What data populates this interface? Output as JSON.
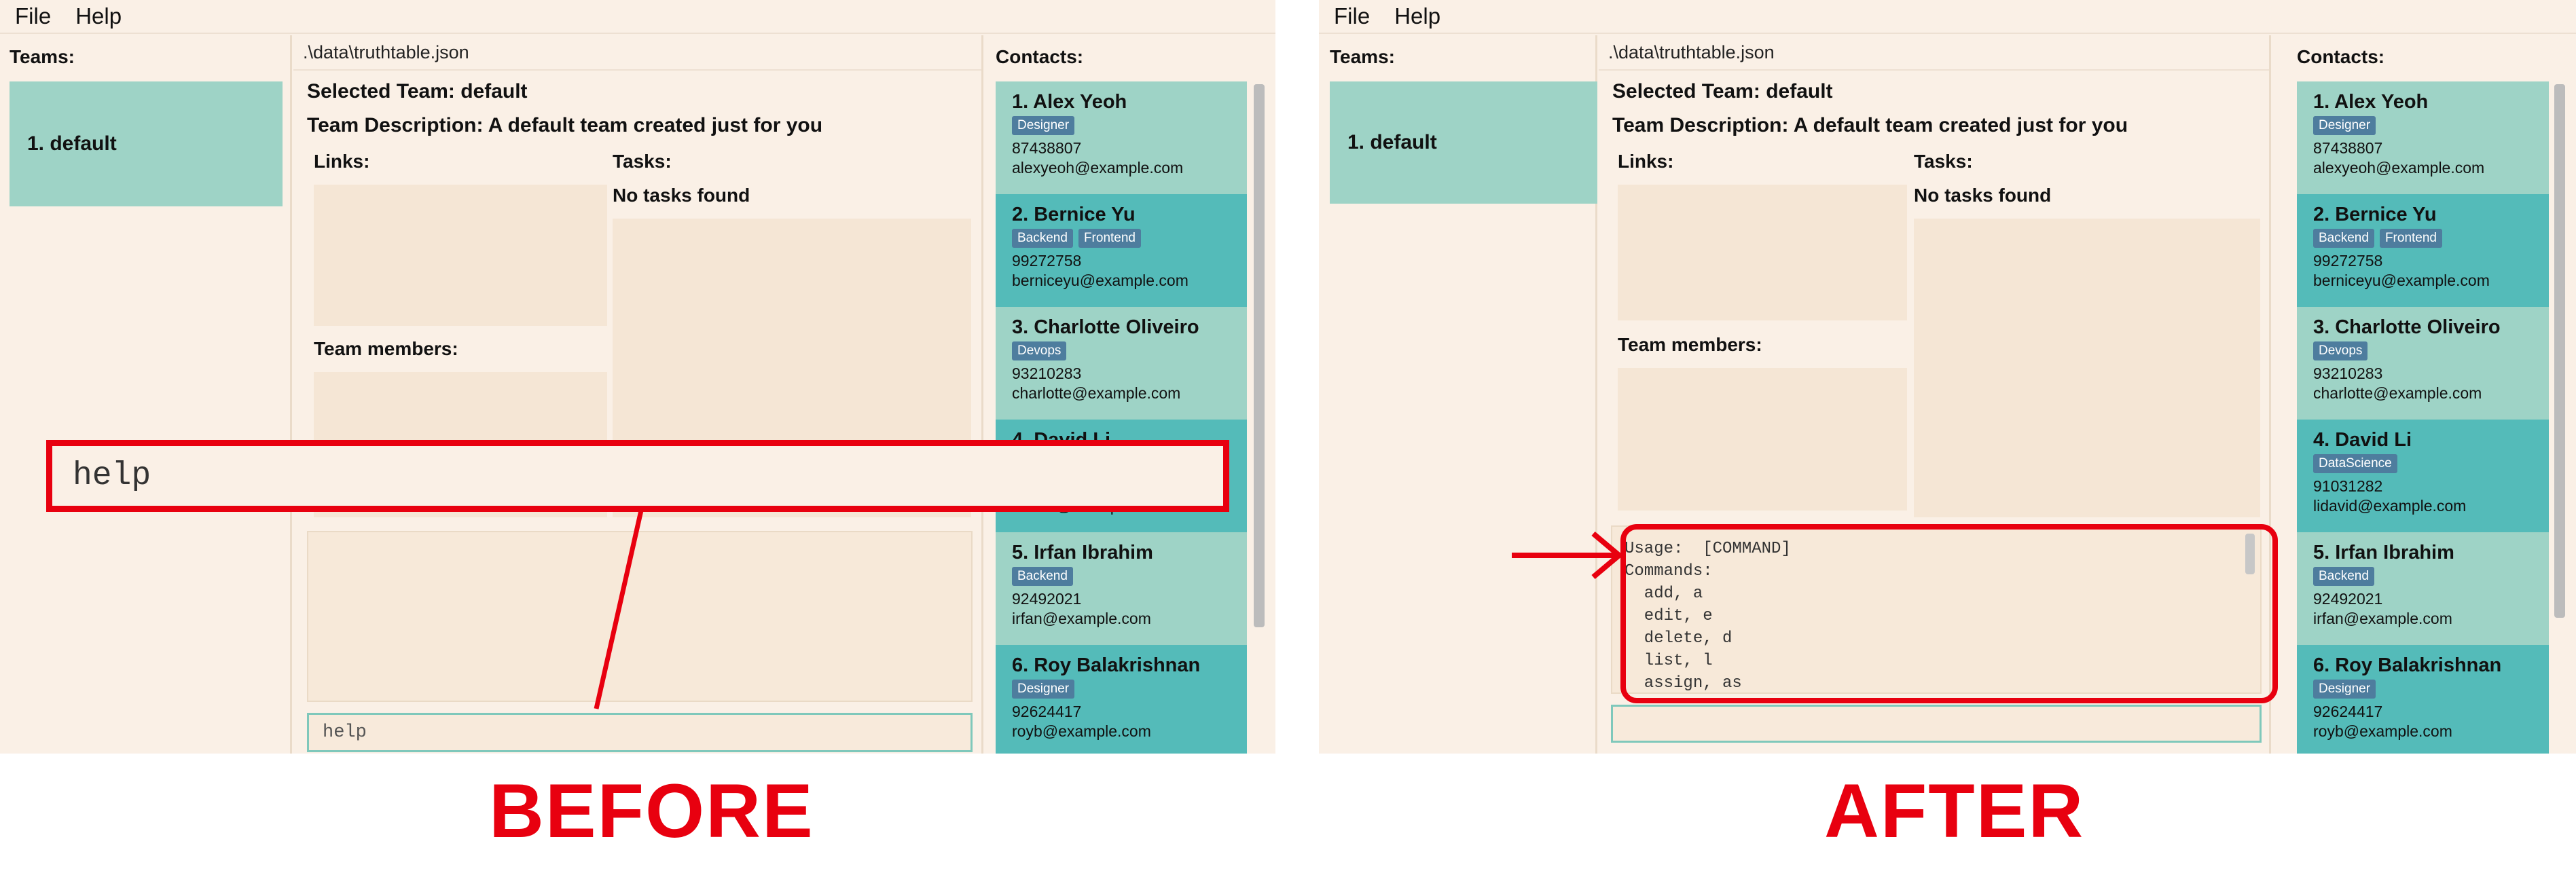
{
  "before": {
    "menu": [
      "File",
      "Help"
    ],
    "teams_title": "Teams:",
    "teams": [
      "1. default"
    ],
    "path": ".\\data\\truthtable.json",
    "selected_team": "Selected Team: default",
    "team_description": "Team Description: A default team created just for you",
    "links_label": "Links:",
    "tasks_label": "Tasks:",
    "no_tasks": "No tasks found",
    "members_label": "Team members:",
    "command_value": "help",
    "overlay_command": "help",
    "contacts_title": "Contacts:",
    "label": "BEFORE"
  },
  "after": {
    "menu": [
      "File",
      "Help"
    ],
    "teams_title": "Teams:",
    "teams": [
      "1. default"
    ],
    "path": ".\\data\\truthtable.json",
    "selected_team": "Selected Team: default",
    "team_description": "Team Description: A default team created just for you",
    "links_label": "Links:",
    "tasks_label": "Tasks:",
    "no_tasks": "No tasks found",
    "members_label": "Team members:",
    "result_text": "Usage:  [COMMAND]\nCommands:\n  add, a\n  edit, e\n  delete, d\n  list, l\n  assign, as",
    "command_value": "",
    "contacts_title": "Contacts:",
    "label": "AFTER"
  },
  "contacts": [
    {
      "name": "1. Alex Yeoh",
      "tags": [
        "Designer"
      ],
      "phone": "87438807",
      "email": "alexyeoh@example.com"
    },
    {
      "name": "2. Bernice Yu",
      "tags": [
        "Backend",
        "Frontend"
      ],
      "phone": "99272758",
      "email": "berniceyu@example.com"
    },
    {
      "name": "3. Charlotte Oliveiro",
      "tags": [
        "Devops"
      ],
      "phone": "93210283",
      "email": "charlotte@example.com"
    },
    {
      "name": "4. David Li",
      "tags": [
        "DataScience"
      ],
      "phone": "91031282",
      "email": "lidavid@example.com"
    },
    {
      "name": "5. Irfan Ibrahim",
      "tags": [
        "Backend"
      ],
      "phone": "92492021",
      "email": "irfan@example.com"
    },
    {
      "name": "6. Roy Balakrishnan",
      "tags": [
        "Designer"
      ],
      "phone": "92624417",
      "email": "royb@example.com"
    }
  ],
  "colors": {
    "annotation_red": "#e8000f",
    "card_light": "#9ed3c6",
    "card_dark": "#54bbb9",
    "tag": "#4e7d9e",
    "background": "#faf0e6"
  }
}
